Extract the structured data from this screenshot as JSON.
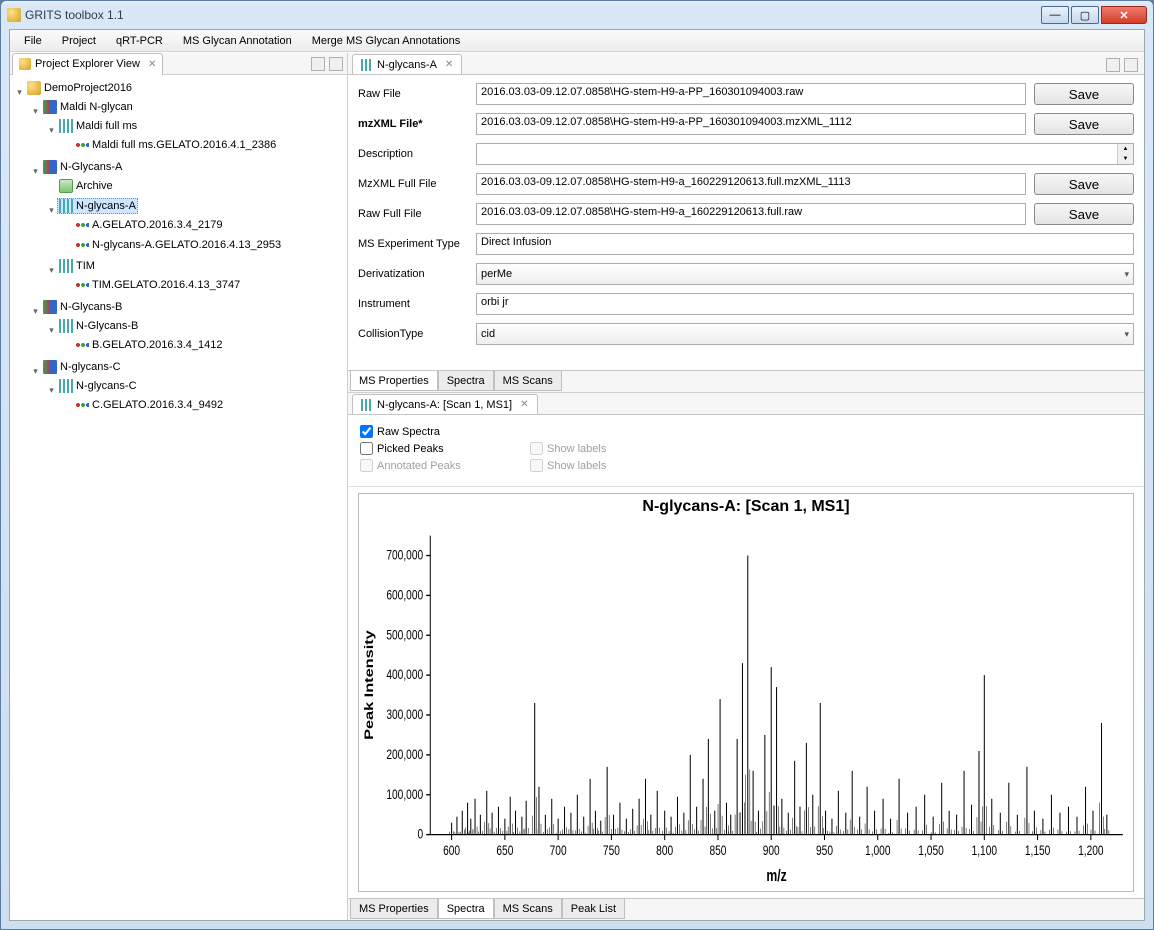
{
  "window": {
    "title": "GRITS toolbox 1.1"
  },
  "menu": [
    "File",
    "Project",
    "qRT-PCR",
    "MS Glycan Annotation",
    "Merge MS Glycan Annotations"
  ],
  "explorer": {
    "title": "Project Explorer View",
    "root": "DemoProject2016",
    "maldi_group": "Maldi N-glycan",
    "maldi_ms": "Maldi full ms",
    "maldi_ms_leaf": "Maldi full ms.GELATO.2016.4.1_2386",
    "ngA": "N-Glycans-A",
    "archive": "Archive",
    "ngA_sel": "N-glycans-A",
    "ngA_l1": "A.GELATO.2016.3.4_2179",
    "ngA_l2": "N-glycans-A.GELATO.2016.4.13_2953",
    "tim": "TIM",
    "tim_leaf": "TIM.GELATO.2016.4.13_3747",
    "ngB": "N-Glycans-B",
    "ngB_c": "N-Glycans-B",
    "ngB_leaf": "B.GELATO.2016.3.4_1412",
    "ngC": "N-glycans-C",
    "ngC_c": "N-glycans-C",
    "ngC_leaf": "C.GELATO.2016.3.4_9492"
  },
  "editor": {
    "tab": "N-glycans-A",
    "rawfile_lbl": "Raw File",
    "rawfile": "2016.03.03-09.12.07.0858\\HG-stem-H9-a-PP_160301094003.raw",
    "mzxml_lbl": "mzXML File*",
    "mzxml": "2016.03.03-09.12.07.0858\\HG-stem-H9-a-PP_160301094003.mzXML_1112",
    "desc_lbl": "Description",
    "desc": "",
    "mzfull_lbl": "MzXML Full File",
    "mzfull": "2016.03.03-09.12.07.0858\\HG-stem-H9-a_160229120613.full.mzXML_1113",
    "rawfull_lbl": "Raw Full File",
    "rawfull": "2016.03.03-09.12.07.0858\\HG-stem-H9-a_160229120613.full.raw",
    "exptype_lbl": "MS Experiment Type",
    "exptype": "Direct Infusion",
    "deriv_lbl": "Derivatization",
    "deriv": "perMe",
    "instr_lbl": "Instrument",
    "instr": "orbi jr",
    "coll_lbl": "CollisionType",
    "coll": "cid",
    "save": "Save",
    "tabs": [
      "MS Properties",
      "Spectra",
      "MS Scans"
    ]
  },
  "spectra": {
    "tab": "N-glycans-A: [Scan 1, MS1]",
    "raw": "Raw Spectra",
    "picked": "Picked Peaks",
    "annot": "Annotated Peaks",
    "showlbl": "Show labels",
    "showlbl2": "Show labels",
    "tabs": [
      "MS Properties",
      "Spectra",
      "MS Scans",
      "Peak List"
    ]
  },
  "chart_data": {
    "type": "bar",
    "title": "N-glycans-A: [Scan 1, MS1]",
    "xlabel": "m/z",
    "ylabel": "Peak Intensity",
    "xlim": [
      580,
      1230
    ],
    "ylim": [
      0,
      750000
    ],
    "xticks": [
      600,
      650,
      700,
      750,
      800,
      850,
      900,
      950,
      1000,
      1050,
      1100,
      1150,
      1200
    ],
    "yticks": [
      0,
      100000,
      200000,
      300000,
      400000,
      500000,
      600000,
      700000
    ],
    "peaks": [
      {
        "x": 600,
        "y": 30000
      },
      {
        "x": 605,
        "y": 45000
      },
      {
        "x": 610,
        "y": 60000
      },
      {
        "x": 615,
        "y": 80000
      },
      {
        "x": 618,
        "y": 40000
      },
      {
        "x": 622,
        "y": 90000
      },
      {
        "x": 627,
        "y": 50000
      },
      {
        "x": 633,
        "y": 110000
      },
      {
        "x": 638,
        "y": 55000
      },
      {
        "x": 644,
        "y": 70000
      },
      {
        "x": 650,
        "y": 40000
      },
      {
        "x": 655,
        "y": 95000
      },
      {
        "x": 660,
        "y": 60000
      },
      {
        "x": 666,
        "y": 45000
      },
      {
        "x": 670,
        "y": 85000
      },
      {
        "x": 678,
        "y": 330000
      },
      {
        "x": 682,
        "y": 120000
      },
      {
        "x": 688,
        "y": 50000
      },
      {
        "x": 694,
        "y": 90000
      },
      {
        "x": 700,
        "y": 40000
      },
      {
        "x": 706,
        "y": 70000
      },
      {
        "x": 712,
        "y": 55000
      },
      {
        "x": 718,
        "y": 100000
      },
      {
        "x": 724,
        "y": 45000
      },
      {
        "x": 730,
        "y": 140000
      },
      {
        "x": 735,
        "y": 60000
      },
      {
        "x": 740,
        "y": 35000
      },
      {
        "x": 746,
        "y": 170000
      },
      {
        "x": 752,
        "y": 50000
      },
      {
        "x": 758,
        "y": 80000
      },
      {
        "x": 764,
        "y": 40000
      },
      {
        "x": 770,
        "y": 65000
      },
      {
        "x": 776,
        "y": 90000
      },
      {
        "x": 782,
        "y": 140000
      },
      {
        "x": 787,
        "y": 50000
      },
      {
        "x": 793,
        "y": 110000
      },
      {
        "x": 800,
        "y": 60000
      },
      {
        "x": 806,
        "y": 45000
      },
      {
        "x": 812,
        "y": 95000
      },
      {
        "x": 818,
        "y": 55000
      },
      {
        "x": 824,
        "y": 200000
      },
      {
        "x": 830,
        "y": 70000
      },
      {
        "x": 836,
        "y": 140000
      },
      {
        "x": 841,
        "y": 240000
      },
      {
        "x": 847,
        "y": 60000
      },
      {
        "x": 852,
        "y": 340000
      },
      {
        "x": 858,
        "y": 80000
      },
      {
        "x": 862,
        "y": 50000
      },
      {
        "x": 868,
        "y": 240000
      },
      {
        "x": 873,
        "y": 430000
      },
      {
        "x": 878,
        "y": 700000
      },
      {
        "x": 883,
        "y": 160000
      },
      {
        "x": 888,
        "y": 60000
      },
      {
        "x": 894,
        "y": 250000
      },
      {
        "x": 900,
        "y": 420000
      },
      {
        "x": 905,
        "y": 370000
      },
      {
        "x": 910,
        "y": 90000
      },
      {
        "x": 916,
        "y": 55000
      },
      {
        "x": 922,
        "y": 185000
      },
      {
        "x": 927,
        "y": 70000
      },
      {
        "x": 933,
        "y": 230000
      },
      {
        "x": 939,
        "y": 100000
      },
      {
        "x": 946,
        "y": 330000
      },
      {
        "x": 951,
        "y": 60000
      },
      {
        "x": 957,
        "y": 40000
      },
      {
        "x": 963,
        "y": 110000
      },
      {
        "x": 970,
        "y": 55000
      },
      {
        "x": 976,
        "y": 160000
      },
      {
        "x": 983,
        "y": 45000
      },
      {
        "x": 990,
        "y": 120000
      },
      {
        "x": 997,
        "y": 60000
      },
      {
        "x": 1005,
        "y": 90000
      },
      {
        "x": 1012,
        "y": 40000
      },
      {
        "x": 1020,
        "y": 140000
      },
      {
        "x": 1028,
        "y": 55000
      },
      {
        "x": 1036,
        "y": 70000
      },
      {
        "x": 1044,
        "y": 100000
      },
      {
        "x": 1052,
        "y": 45000
      },
      {
        "x": 1060,
        "y": 130000
      },
      {
        "x": 1067,
        "y": 60000
      },
      {
        "x": 1074,
        "y": 50000
      },
      {
        "x": 1081,
        "y": 160000
      },
      {
        "x": 1088,
        "y": 75000
      },
      {
        "x": 1095,
        "y": 210000
      },
      {
        "x": 1100,
        "y": 400000
      },
      {
        "x": 1107,
        "y": 90000
      },
      {
        "x": 1115,
        "y": 55000
      },
      {
        "x": 1123,
        "y": 130000
      },
      {
        "x": 1131,
        "y": 50000
      },
      {
        "x": 1140,
        "y": 170000
      },
      {
        "x": 1147,
        "y": 60000
      },
      {
        "x": 1155,
        "y": 40000
      },
      {
        "x": 1163,
        "y": 100000
      },
      {
        "x": 1171,
        "y": 55000
      },
      {
        "x": 1179,
        "y": 70000
      },
      {
        "x": 1187,
        "y": 45000
      },
      {
        "x": 1195,
        "y": 120000
      },
      {
        "x": 1202,
        "y": 60000
      },
      {
        "x": 1210,
        "y": 280000
      },
      {
        "x": 1215,
        "y": 50000
      }
    ]
  }
}
